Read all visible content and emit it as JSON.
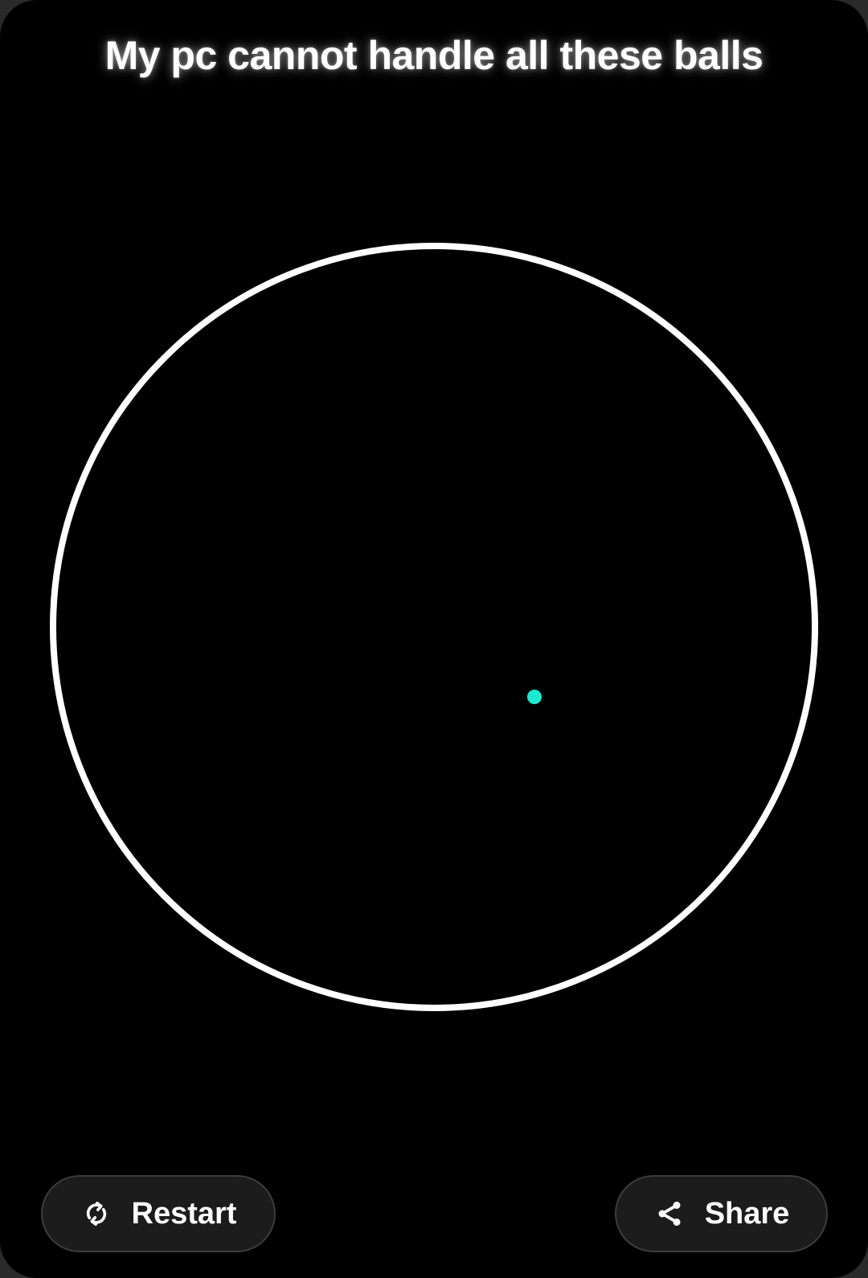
{
  "header": {
    "title": "My pc cannot handle all these balls"
  },
  "game": {
    "arena_ring_color": "#ffffff",
    "ball_color": "#1de9d2",
    "background_color": "#000000"
  },
  "controls": {
    "restart_label": "Restart",
    "restart_icon": "refresh-icon",
    "share_label": "Share",
    "share_icon": "share-icon"
  }
}
